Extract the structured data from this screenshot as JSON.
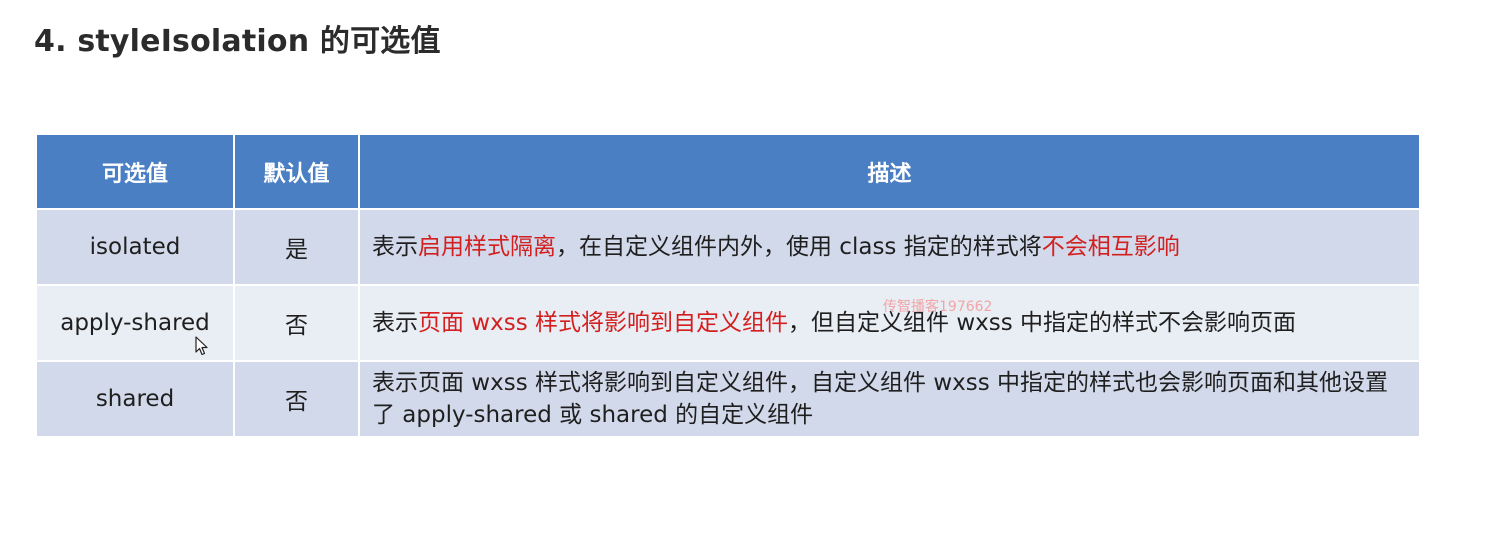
{
  "page": {
    "title": "4. styleIsolation 的可选值"
  },
  "table": {
    "headers": {
      "value": "可选值",
      "default": "默认值",
      "description": "描述"
    },
    "rows": [
      {
        "value": "isolated",
        "value_color": "#1f1f1f",
        "default": "是",
        "desc_parts": [
          {
            "text": "表示"
          },
          {
            "text": "启用样式隔离",
            "highlight": true
          },
          {
            "text": "，在自定义组件内外，使用 class 指定的样式将"
          },
          {
            "text": "不会相互影响",
            "highlight": true
          }
        ]
      },
      {
        "value": "apply-shared",
        "value_color": "#1f1f1f",
        "default": "否",
        "desc_parts": [
          {
            "text": "表示"
          },
          {
            "text": "页面 wxss 样式将影响到自定义组件",
            "highlight": true
          },
          {
            "text": "，但自定义组件 wxss 中指定的样式不会影响页面"
          }
        ]
      },
      {
        "value": "shared",
        "value_color": "#d41f1f",
        "default": "否",
        "desc_parts": [
          {
            "text": "表示页面 wxss 样式将影响到自定义组件，自定义组件 wxss 中指定的样式也会影响页面和其他设置了 apply-shared 或 shared 的自定义组件"
          }
        ]
      }
    ]
  },
  "watermark": "传智播客197662",
  "colors": {
    "header_bg": "#4a7fc4",
    "row_bg": "#d1d9ea",
    "row_alt_bg": "#e9edf4",
    "highlight": "#d41f1f"
  },
  "icons": {
    "cursor": "mouse-pointer-icon"
  }
}
